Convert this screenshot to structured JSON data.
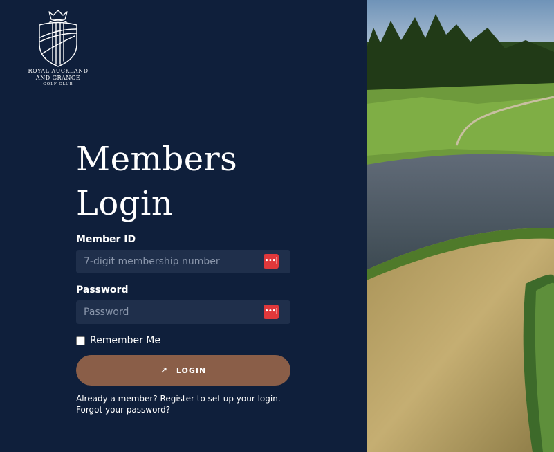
{
  "logo": {
    "line1": "ROYAL AUCKLAND",
    "line2": "AND GRANGE",
    "line3": "— GOLF CLUB —"
  },
  "login": {
    "title_line1": "Members",
    "title_line2": "Login",
    "member_id_label": "Member ID",
    "member_id_placeholder": "7-digit membership number",
    "member_id_value": "",
    "password_label": "Password",
    "password_placeholder": "Password",
    "password_value": "",
    "password_manager_icon": "•••|",
    "remember_label": "Remember Me",
    "remember_checked": false,
    "login_button_icon": "↗",
    "login_button_label": "LOGIN",
    "register_link": "Already a member? Register to set up your login.",
    "forgot_link": "Forgot your password?"
  },
  "colors": {
    "panel_bg": "#0f1f3b",
    "input_bg": "#1f2f4b",
    "button_bg": "#8a5e48",
    "password_manager_icon": "#e0383b"
  },
  "icons": {
    "logo": "crest-icon",
    "password_manager": "password-manager-icon",
    "login": "arrow-up-right-icon"
  }
}
